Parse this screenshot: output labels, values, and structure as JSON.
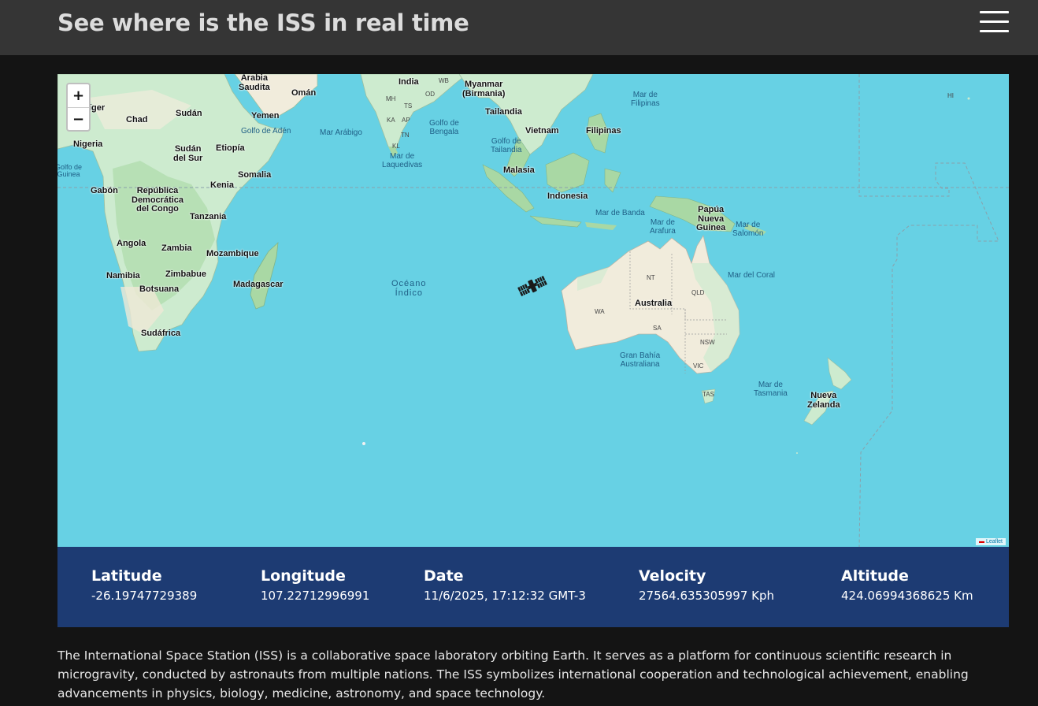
{
  "header": {
    "title": "See where is the ISS in real time",
    "menu_icon": "hamburger-menu-icon"
  },
  "map": {
    "zoom_in_label": "+",
    "zoom_out_label": "−",
    "attribution": "Leaflet",
    "marker_icon": "satellite-icon",
    "labels": {
      "arabia": "Arabia\nSaudita",
      "oman": "Omán",
      "yemen": "Yemen",
      "niger": "íger",
      "chad": "Chad",
      "sudan": "Sudán",
      "golfo_aden": "Golfo de Adén",
      "mar_arabigo": "Mar Arábigo",
      "nigeria": "Nigeria",
      "sudan_sur": "Sudán\ndel Sur",
      "etiopia": "Etiopía",
      "golfo_guinea": "Golfo de\nGuinea",
      "somalia": "Somalia",
      "kenia": "Kenia",
      "gabon": "Gabón",
      "rep_congo": "República\nDemocrática\ndel Congo",
      "tanzania": "Tanzania",
      "angola": "Angola",
      "zambia": "Zambia",
      "mozambique": "Mozambique",
      "namibia": "Namibia",
      "zimbabue": "Zimbabue",
      "botsuana": "Botsuana",
      "madagascar": "Madagascar",
      "sudafrica": "Sudáfrica",
      "india": "India",
      "myanmar": "Myanmar\n(Birmania)",
      "golfo_bengala": "Golfo de\nBengala",
      "mar_laquedivas": "Mar de\nLaquedivas",
      "tailandia": "Tailandia",
      "golfo_tailandia": "Golfo de\nTailandia",
      "vietnam": "Vietnam",
      "filipinas": "Filipinas",
      "mar_filipinas": "Mar de\nFilipinas",
      "malasia": "Malasia",
      "indonesia": "Indonesia",
      "mar_banda": "Mar de Banda",
      "papua": "Papúa\nNueva\nGuinea",
      "mar_arafura": "Mar de\nArafura",
      "mar_salomon": "Mar de\nSalomón",
      "oceano_indico": "Océano\nÍndico",
      "australia": "Australia",
      "mar_coral": "Mar del Coral",
      "gran_bahia": "Gran Bahía\nAustraliana",
      "mar_tasmania": "Mar de\nTasmania",
      "nueva_zelanda": "Nueva\nZelanda",
      "nt": "NT",
      "qld": "QLD",
      "wa": "WA",
      "sa": "SA",
      "nsw": "NSW",
      "vic": "VIC",
      "tas": "TAS",
      "hi": "HI",
      "wb": "WB",
      "mh": "MH",
      "ts": "TS",
      "od": "OD",
      "ka": "KA",
      "ap": "AP",
      "tn": "TN",
      "kl": "KL"
    }
  },
  "stats": {
    "latitude": {
      "label": "Latitude",
      "value": "-26.19747729389"
    },
    "longitude": {
      "label": "Longitude",
      "value": "107.22712996991"
    },
    "date": {
      "label": "Date",
      "value": "11/6/2025, 17:12:32 GMT-3"
    },
    "velocity": {
      "label": "Velocity",
      "value": "27564.635305997 Kph"
    },
    "altitude": {
      "label": "Altitude",
      "value": "424.06994368625 Km"
    }
  },
  "description": "The International Space Station (ISS) is a collaborative space laboratory orbiting Earth. It serves as a platform for continuous scientific research in microgravity, conducted by astronauts from multiple nations. The ISS symbolizes international cooperation and technological achievement, enabling advancements in physics, biology, medicine, astronomy, and space technology.",
  "colors": {
    "header_bg": "#353535",
    "page_bg": "#141414",
    "ocean": "#67d1e4",
    "land": "#cdebcf",
    "stats_bg": "#1d3b73"
  }
}
